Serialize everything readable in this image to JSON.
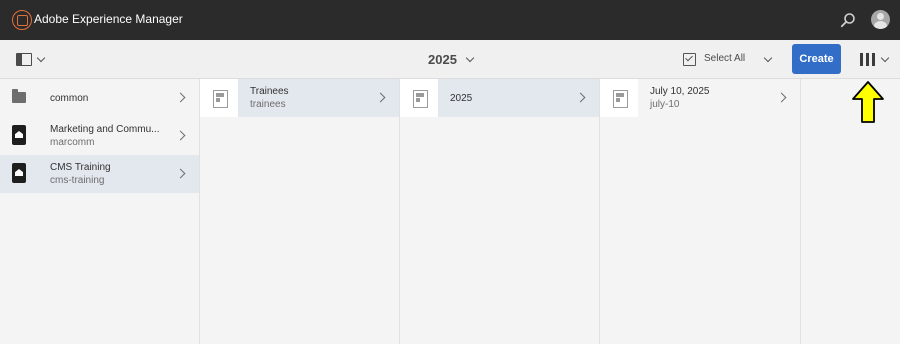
{
  "shell": {
    "title": "Adobe Experience Manager",
    "logo_icon": "aem-logo-icon",
    "search_icon": "search-icon",
    "avatar_icon": "user-avatar-icon"
  },
  "actionbar": {
    "breadcrumb": "2025",
    "select_all_label": "Select All",
    "create_label": "Create",
    "create_color": "#326ec8",
    "view_icon": "column-view-icon"
  },
  "columns": [
    {
      "items": [
        {
          "title": "common",
          "subtitle": "",
          "icon": "folder-icon",
          "selected": false
        },
        {
          "title": "Marketing and Commu...",
          "subtitle": "marcomm",
          "icon": "site-icon",
          "selected": false
        },
        {
          "title": "CMS Training",
          "subtitle": "cms-training",
          "icon": "site-icon",
          "selected": true
        }
      ]
    },
    {
      "items": [
        {
          "title": "Trainees",
          "subtitle": "trainees",
          "icon": "page-thumbnail-icon",
          "selected": true
        }
      ]
    },
    {
      "items": [
        {
          "title": "2025",
          "subtitle": "",
          "icon": "page-thumbnail-icon",
          "selected": true
        }
      ]
    },
    {
      "items": [
        {
          "title": "July 10, 2025",
          "subtitle": "july-10",
          "icon": "page-thumbnail-icon",
          "selected": false
        }
      ]
    }
  ],
  "annotation": {
    "icon": "yellow-arrow-icon",
    "color": "#ffff00"
  }
}
